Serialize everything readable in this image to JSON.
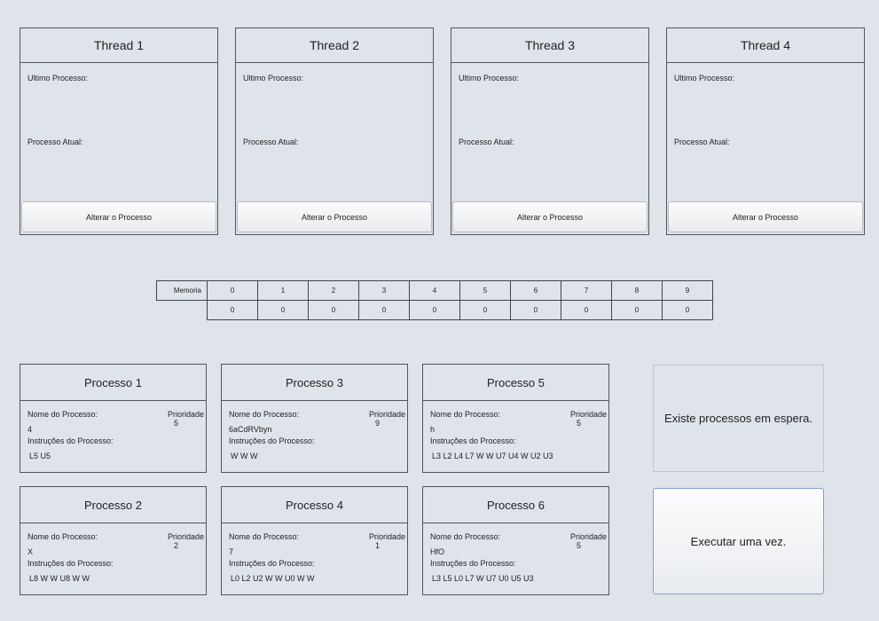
{
  "threads": [
    {
      "title": "Thread 1",
      "last_label": "Ultimo Processo:",
      "current_label": "Processo Atual:",
      "button": "Alterar o Processo"
    },
    {
      "title": "Thread 2",
      "last_label": "Ultimo Processo:",
      "current_label": "Processo Atual:",
      "button": "Alterar o Processo"
    },
    {
      "title": "Thread 3",
      "last_label": "Ultimo Processo:",
      "current_label": "Processo Atual:",
      "button": "Alterar o Processo"
    },
    {
      "title": "Thread 4",
      "last_label": "Ultimo Processo:",
      "current_label": "Processo Atual:",
      "button": "Alterar o Processo"
    }
  ],
  "memory": {
    "label": "Memoria",
    "indices": [
      "0",
      "1",
      "2",
      "3",
      "4",
      "5",
      "6",
      "7",
      "8",
      "9"
    ],
    "values": [
      "0",
      "0",
      "0",
      "0",
      "0",
      "0",
      "0",
      "0",
      "0",
      "0"
    ]
  },
  "processes": [
    {
      "title": "Processo 1",
      "name_label": "Nome do Processo:",
      "priority_label": "Prioridade",
      "priority": "5",
      "name": "4",
      "instr_label": "Instruções do Processo:",
      "instructions": "L5 U5"
    },
    {
      "title": "Processo 3",
      "name_label": "Nome do Processo:",
      "priority_label": "Prioridade",
      "priority": "9",
      "name": "6aCdRVbyn",
      "instr_label": "Instruções do Processo:",
      "instructions": "W W W"
    },
    {
      "title": "Processo 5",
      "name_label": "Nome do Processo:",
      "priority_label": "Prioridade",
      "priority": "5",
      "name": "h",
      "instr_label": "Instruções do Processo:",
      "instructions": "L3 L2 L4 L7 W W U7 U4 W U2 U3"
    },
    {
      "title": "Processo 2",
      "name_label": "Nome do Processo:",
      "priority_label": "Prioridade",
      "priority": "2",
      "name": "X",
      "instr_label": "Instruções do Processo:",
      "instructions": "L8 W W U8 W W"
    },
    {
      "title": "Processo 4",
      "name_label": "Nome do Processo:",
      "priority_label": "Prioridade",
      "priority": "1",
      "name": "7",
      "instr_label": "Instruções do Processo:",
      "instructions": "L0 L2 U2 W W U0 W W"
    },
    {
      "title": "Processo 6",
      "name_label": "Nome do Processo:",
      "priority_label": "Prioridade",
      "priority": "5",
      "name": "HfO",
      "instr_label": "Instruções do Processo:",
      "instructions": "L3 L5 L0 L7 W U7 U0 U5 U3"
    }
  ],
  "status_text": "Existe processos em espera.",
  "run_button": "Executar uma vez."
}
